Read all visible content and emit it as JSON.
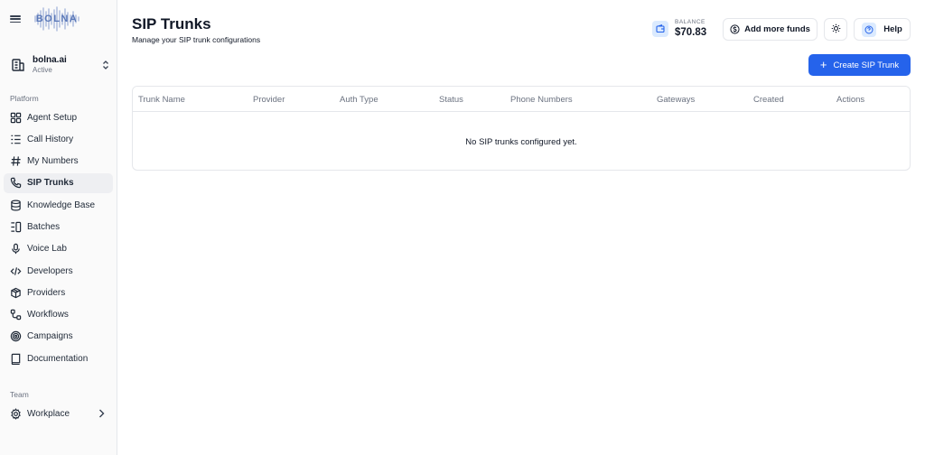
{
  "sidebar": {
    "logo_text": "BOLNA",
    "org": {
      "name": "bolna.ai",
      "status": "Active"
    },
    "platform_label": "Platform",
    "items": [
      {
        "label": "Agent Setup",
        "icon": "grid-icon"
      },
      {
        "label": "Call History",
        "icon": "list-icon"
      },
      {
        "label": "My Numbers",
        "icon": "hash-icon"
      },
      {
        "label": "SIP Trunks",
        "icon": "phone-icon",
        "active": true
      },
      {
        "label": "Knowledge Base",
        "icon": "database-icon"
      },
      {
        "label": "Batches",
        "icon": "batches-icon"
      },
      {
        "label": "Voice Lab",
        "icon": "mic-icon"
      },
      {
        "label": "Developers",
        "icon": "code-icon"
      },
      {
        "label": "Providers",
        "icon": "package-icon"
      },
      {
        "label": "Workflows",
        "icon": "workflow-icon"
      },
      {
        "label": "Campaigns",
        "icon": "target-icon"
      },
      {
        "label": "Documentation",
        "icon": "book-icon"
      }
    ],
    "team_label": "Team",
    "workplace_label": "Workplace"
  },
  "header": {
    "title": "SIP Trunks",
    "subtitle": "Manage your SIP trunk configurations",
    "balance_label": "BALANCE",
    "balance_value": "$70.83",
    "add_funds_label": "Add more funds",
    "help_label": "Help"
  },
  "create_button_label": "Create SIP Trunk",
  "table": {
    "columns": [
      "Trunk Name",
      "Provider",
      "Auth Type",
      "Status",
      "Phone Numbers",
      "Gateways",
      "Created",
      "Actions"
    ],
    "empty_message": "No SIP trunks configured yet."
  },
  "colors": {
    "accent": "#2563eb",
    "active_bg": "#eeeff2"
  }
}
